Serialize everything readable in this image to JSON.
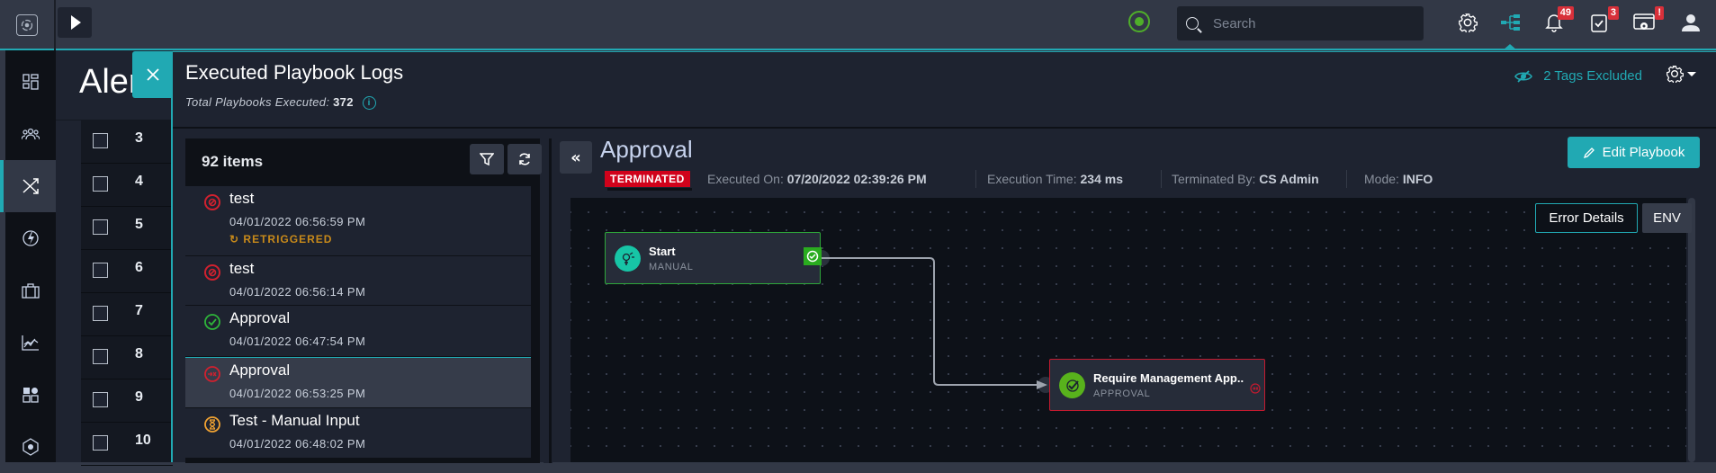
{
  "topbar": {
    "search_placeholder": "Search",
    "icons": [
      "settings-icon",
      "playbook-tree-icon",
      "notifications-icon",
      "tasks-icon",
      "system-alert-icon",
      "user-icon"
    ],
    "notifications_badge": "49",
    "tasks_badge": "3",
    "system_badge": "!"
  },
  "sidenav": {
    "items": [
      "dashboard",
      "people",
      "shuffle-playbooks",
      "automation",
      "briefcase",
      "analytics",
      "widgets",
      "integrations"
    ],
    "active": "shuffle-playbooks"
  },
  "alerts": {
    "title": "Alerts",
    "title_visible": "Aler",
    "rows": [
      "3",
      "4",
      "5",
      "6",
      "7",
      "8",
      "9",
      "10"
    ]
  },
  "drawer": {
    "title": "Executed Playbook Logs",
    "subtitle_label": "Total Playbooks Executed:",
    "subtitle_value": "372",
    "tags_excluded": "2 Tags Excluded"
  },
  "list": {
    "count_label": "92 items",
    "items": [
      {
        "name": "test",
        "date": "04/01/2022 06:56:59 PM",
        "status": "terminated",
        "retriggered": "RETRIGGERED"
      },
      {
        "name": "test",
        "date": "04/01/2022 06:56:14 PM",
        "status": "terminated"
      },
      {
        "name": "Approval",
        "date": "04/01/2022 06:47:54 PM",
        "status": "finished"
      },
      {
        "name": "Approval",
        "date": "04/01/2022 06:53:25 PM",
        "status": "failed",
        "selected": true
      },
      {
        "name": "Test - Manual Input",
        "date": "04/01/2022 06:48:02 PM",
        "status": "awaiting"
      }
    ]
  },
  "detail": {
    "title": "Approval",
    "status_badge": "TERMINATED",
    "executed_on_label": "Executed On:",
    "executed_on_value": "07/20/2022 02:39:26 PM",
    "execution_time_label": "Execution Time:",
    "execution_time_value": "234 ms",
    "terminated_by_label": "Terminated By:",
    "terminated_by_value": "CS Admin",
    "mode_label": "Mode:",
    "mode_value": "INFO",
    "edit_button": "Edit Playbook",
    "error_details_button": "Error Details",
    "env_button": "ENV"
  },
  "canvas": {
    "nodes": [
      {
        "title": "Start",
        "type": "MANUAL",
        "status": "success"
      },
      {
        "title": "Require Management App..",
        "type": "APPROVAL",
        "status": "failed"
      }
    ]
  },
  "colors": {
    "accent": "#21a9b3",
    "danger": "#d0021b",
    "success": "#2ea73a",
    "warning": "#c88a1a"
  }
}
